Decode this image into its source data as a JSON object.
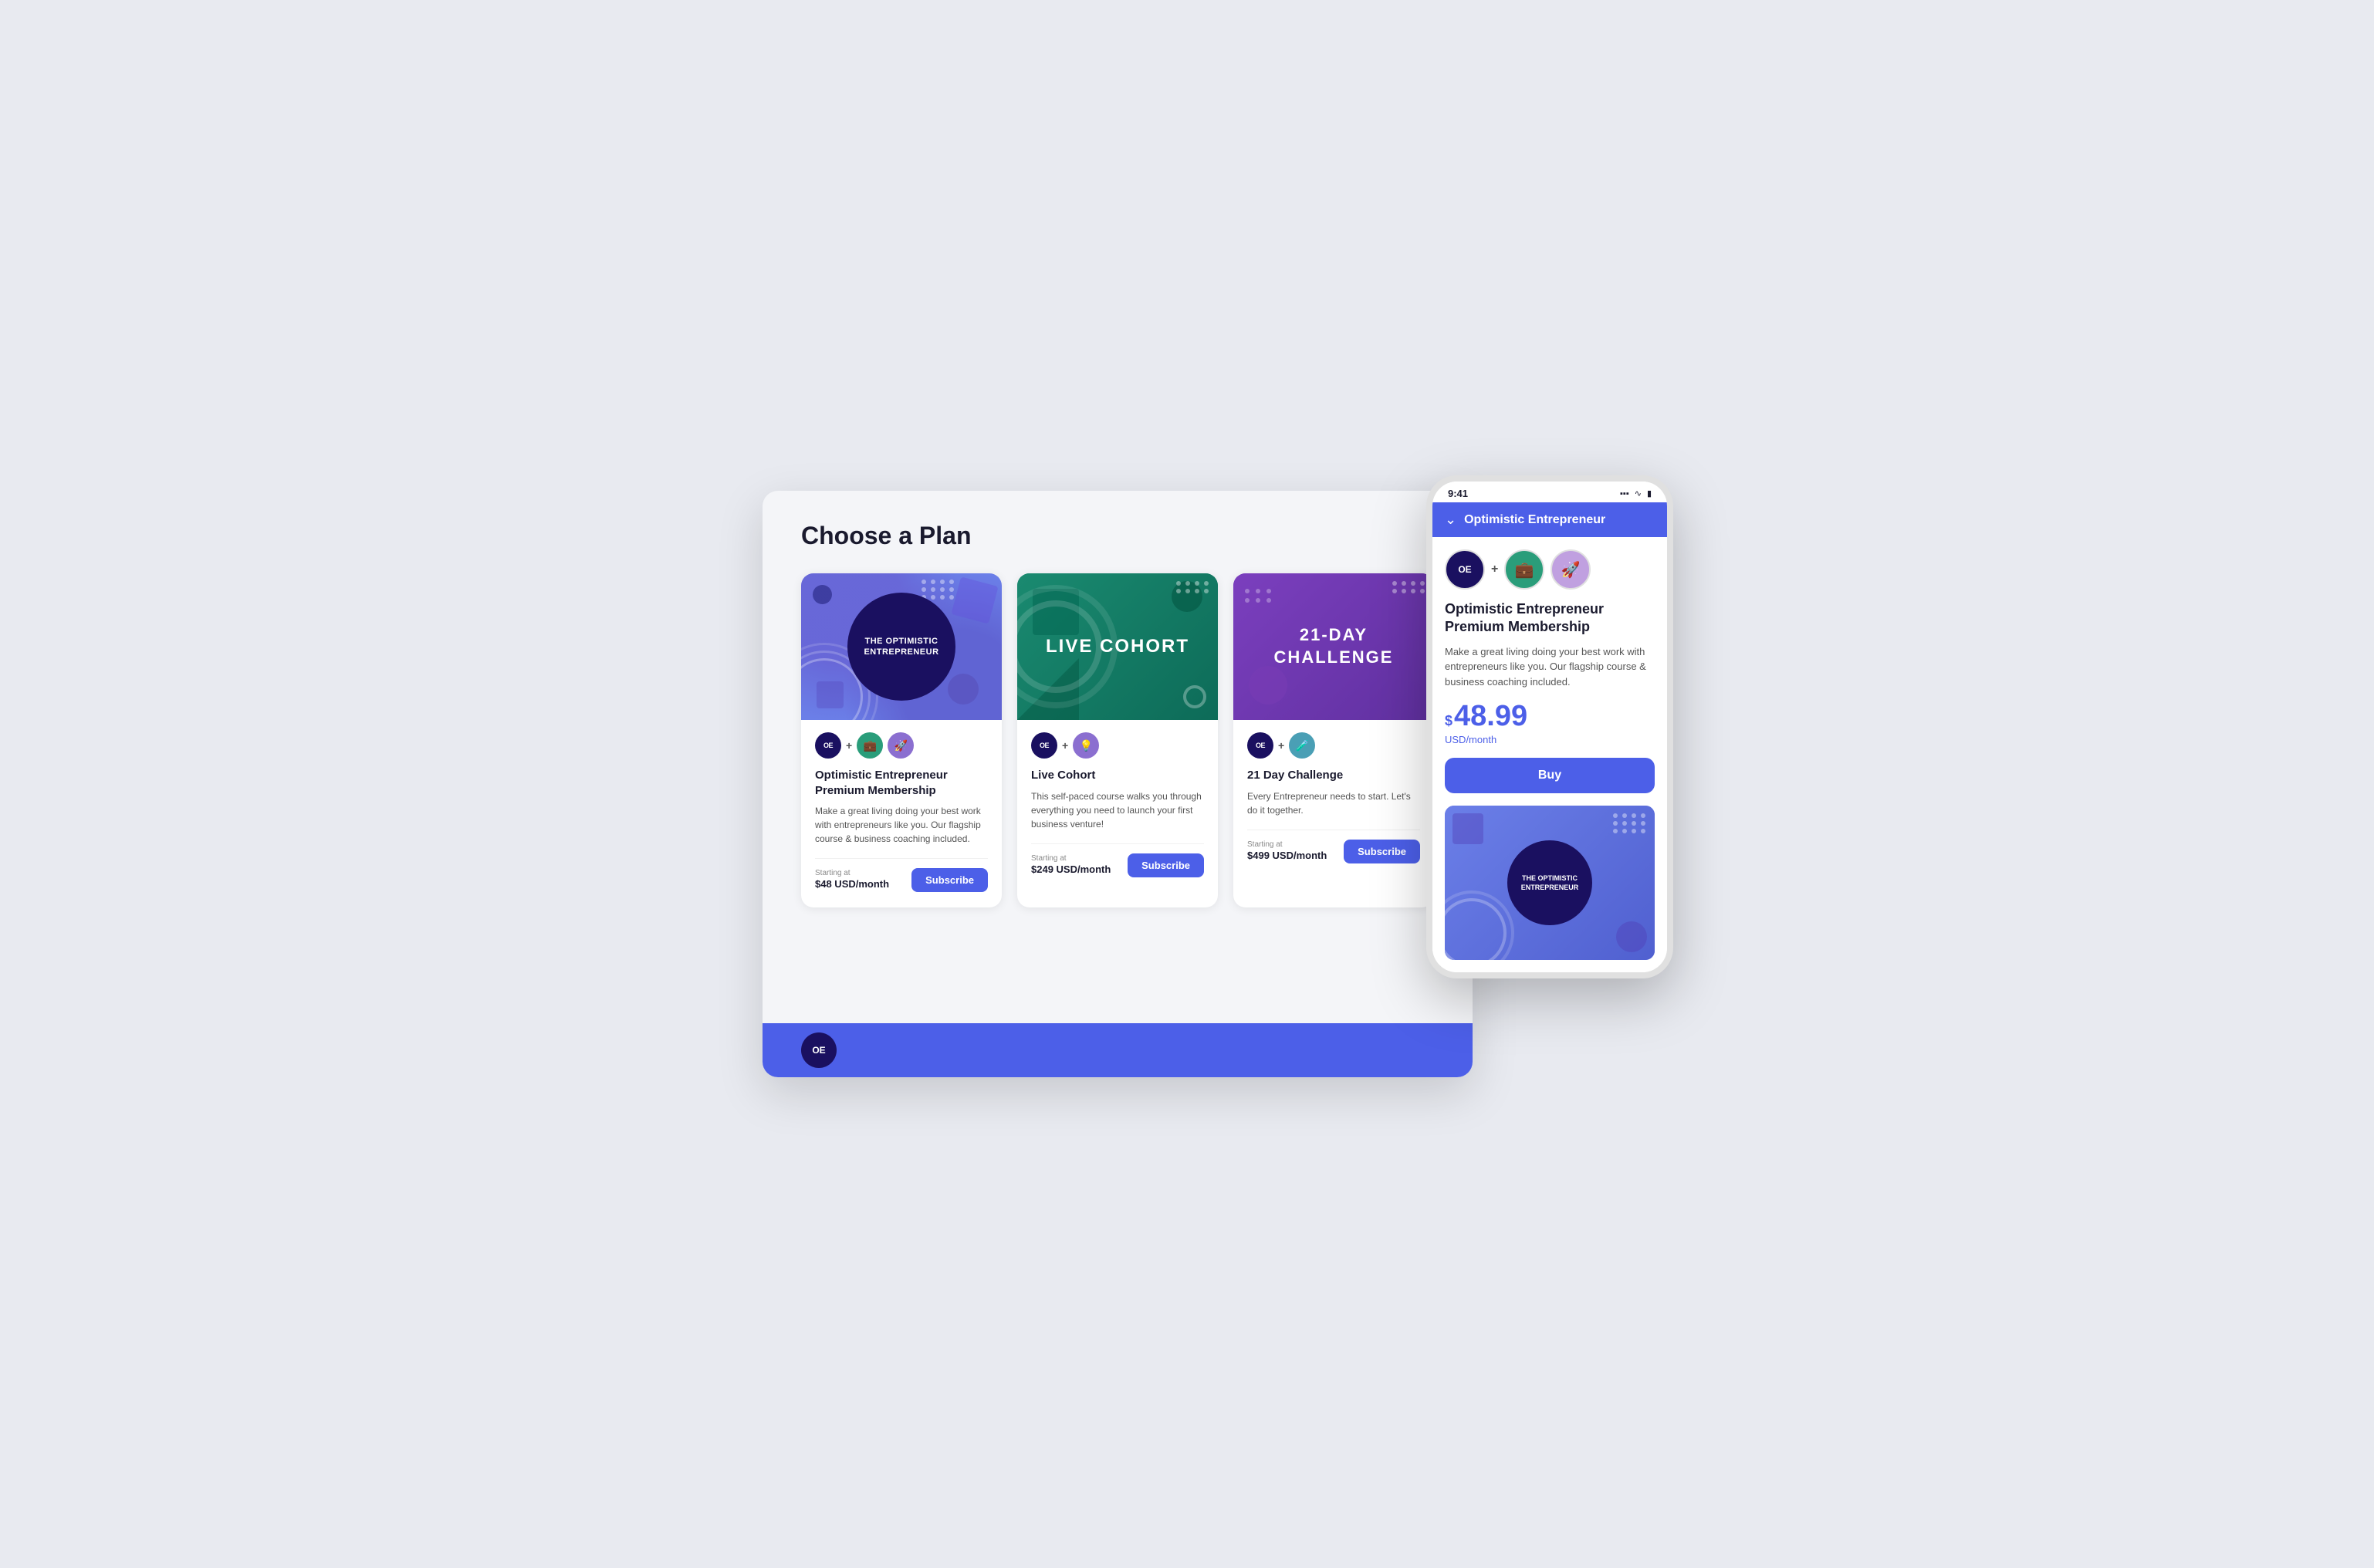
{
  "page": {
    "title": "Choose a Plan",
    "background": "#e8eaf0"
  },
  "plans": [
    {
      "id": "premium",
      "image_title": "THE OPTIMISTIC ENTREPRENEUR",
      "image_bg": "blue-purple",
      "icon1": "OE",
      "icon2": "💼",
      "icon3": "🚀",
      "name": "Optimistic Entrepreneur Premium Membership",
      "description": "Make a great living doing your best work with entrepreneurs like you. Our flagship course & business coaching included.",
      "starting_at": "Starting at",
      "price": "$48 USD/month",
      "price_prefix": "$48",
      "price_suffix": "USD/month",
      "subscribe_label": "Subscribe"
    },
    {
      "id": "cohort",
      "image_title": "LIVE COHORT",
      "image_bg": "green",
      "icon1": "OE",
      "icon2": "💡",
      "name": "Live Cohort",
      "description": "This self-paced course walks you through everything you need to launch your first business venture!",
      "starting_at": "Starting at",
      "price": "$249 USD/month",
      "price_prefix": "$249",
      "price_suffix": "USD/month",
      "subscribe_label": "Subscribe"
    },
    {
      "id": "challenge",
      "image_title": "21-DAY CHALLENGE",
      "image_bg": "purple",
      "icon1": "OE",
      "icon2": "🧪",
      "name": "21 Day Challenge",
      "description": "Every Entrepreneur needs to start. Let's do it together.",
      "starting_at": "Starting at",
      "price": "$499 USD/month",
      "price_prefix": "$499",
      "price_suffix": "USD/month",
      "subscribe_label": "Subscribe"
    }
  ],
  "footer": {
    "logo": "OE"
  },
  "mobile": {
    "status_time": "9:41",
    "status_icons": "▪▪▪ ▾ ▮",
    "header_title": "Optimistic Entrepreneur",
    "plan_name": "Optimistic Entrepreneur Premium Membership",
    "plan_desc": "Make a great living doing your best work with entrepreneurs like you. Our flagship course & business coaching included.",
    "price_dollar": "$",
    "price_num": "48.99",
    "price_period": "USD/month",
    "buy_label": "Buy",
    "icon1": "OE",
    "image_title_line1": "THE OPTIMISTIC",
    "image_title_line2": "ENTREPRENEUR"
  }
}
